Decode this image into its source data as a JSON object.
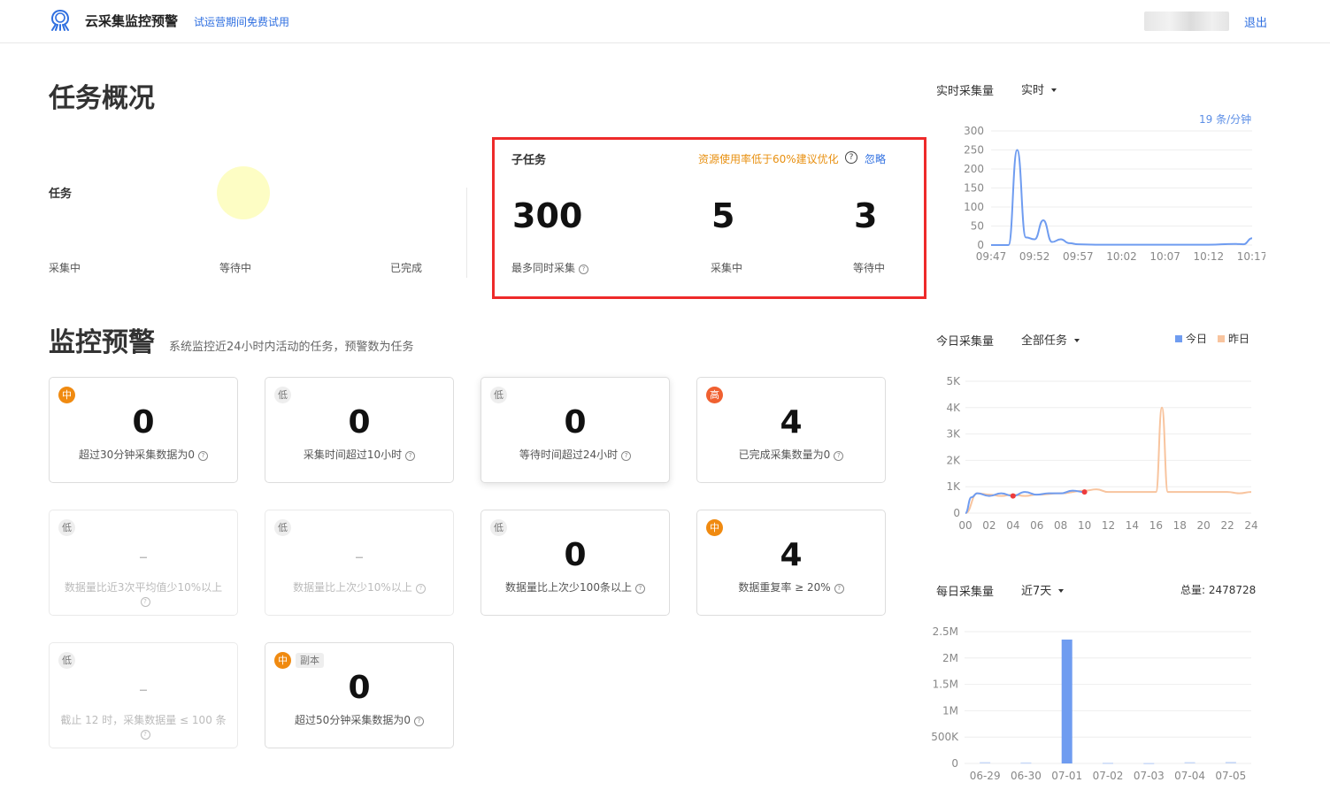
{
  "header": {
    "app_title": "云采集监控预警",
    "trial_text": "试运营期间免费试用",
    "logout": "退出"
  },
  "overview": {
    "title": "任务概况",
    "task_label": "任务",
    "legend": [
      "采集中",
      "等待中",
      "已完成"
    ],
    "subtask": {
      "title": "子任务",
      "warning": "资源使用率低于60%建议优化",
      "ignore": "忽略",
      "stats": [
        {
          "value": "300",
          "label": "最多同时采集"
        },
        {
          "value": "5",
          "label": "采集中"
        },
        {
          "value": "3",
          "label": "等待中"
        }
      ]
    }
  },
  "monitor": {
    "title": "监控预警",
    "subtitle": "系统监控近24小时内活动的任务，预警数为任务",
    "cards": [
      {
        "level": "中",
        "value": "0",
        "desc": "超过30分钟采集数据为0"
      },
      {
        "level": "低",
        "value": "0",
        "desc": "采集时间超过10小时"
      },
      {
        "level": "低",
        "value": "0",
        "desc": "等待时间超过24小时"
      },
      {
        "level": "高",
        "value": "4",
        "desc": "已完成采集数量为0"
      },
      {
        "level": "低",
        "value": "–",
        "desc": "数据量比近3次平均值少10%以上"
      },
      {
        "level": "低",
        "value": "–",
        "desc": "数据量比上次少10%以上"
      },
      {
        "level": "低",
        "value": "0",
        "desc": "数据量比上次少100条以上"
      },
      {
        "level": "中",
        "value": "4",
        "desc": "数据重复率 ≥ 20%"
      },
      {
        "level": "低",
        "value": "–",
        "desc": "截止 12 时，采集数据量 ≤ 100 条"
      },
      {
        "level": "中",
        "tag": "副本",
        "value": "0",
        "desc": "超过50分钟采集数据为0"
      }
    ]
  },
  "realtime": {
    "title": "实时采集量",
    "select": "实时",
    "rate": "19 条/分钟"
  },
  "today": {
    "title": "今日采集量",
    "select": "全部任务",
    "legend_today": "今日",
    "legend_yesterday": "昨日"
  },
  "daily": {
    "title": "每日采集量",
    "select": "近7天",
    "total": "总量: 2478728"
  },
  "colors": {
    "blue": "#6f9cf0",
    "orange": "#f8c49e",
    "accent": "#2f6fe0",
    "alert_red": "#ee2a2a"
  },
  "chart_data": [
    {
      "type": "line",
      "name": "实时采集量",
      "x_ticks": [
        "09:47",
        "09:52",
        "09:57",
        "10:02",
        "10:07",
        "10:12",
        "10:17"
      ],
      "y_ticks": [
        0,
        50,
        100,
        150,
        200,
        250,
        300
      ],
      "ylim": [
        0,
        300
      ],
      "x": [
        "09:47",
        "09:48",
        "09:49",
        "09:50",
        "09:51",
        "09:52",
        "09:53",
        "09:54",
        "09:55",
        "09:56",
        "09:57",
        "09:59",
        "10:02",
        "10:07",
        "10:12",
        "10:15",
        "10:16",
        "10:17"
      ],
      "values": [
        0,
        0,
        0,
        250,
        20,
        15,
        65,
        8,
        15,
        5,
        2,
        1,
        1,
        1,
        1,
        3,
        2,
        18
      ]
    },
    {
      "type": "line",
      "name": "今日采集量",
      "x_ticks": [
        "00",
        "02",
        "04",
        "06",
        "08",
        "10",
        "12",
        "14",
        "16",
        "18",
        "20",
        "22",
        "24"
      ],
      "y_ticks": [
        "0",
        "1K",
        "2K",
        "3K",
        "4K",
        "5K"
      ],
      "ylim": [
        0,
        5000
      ],
      "series": [
        {
          "name": "今日",
          "x": [
            0,
            0.5,
            1,
            2,
            3,
            4,
            5,
            6,
            7,
            8,
            9,
            10
          ],
          "values": [
            0,
            600,
            750,
            650,
            750,
            650,
            800,
            700,
            750,
            750,
            850,
            800
          ]
        },
        {
          "name": "昨日",
          "x": [
            0,
            1,
            2,
            3,
            4,
            5,
            6,
            8,
            10,
            11,
            12,
            14,
            15,
            16,
            16.5,
            17,
            17.5,
            18,
            20,
            22,
            23,
            24
          ],
          "values": [
            0,
            750,
            700,
            650,
            700,
            650,
            700,
            750,
            850,
            900,
            800,
            800,
            800,
            800,
            4000,
            800,
            800,
            800,
            800,
            800,
            750,
            800
          ]
        }
      ]
    },
    {
      "type": "bar",
      "name": "每日采集量",
      "categories": [
        "06-29",
        "06-30",
        "07-01",
        "07-02",
        "07-03",
        "07-04",
        "07-05"
      ],
      "y_ticks": [
        "0",
        "500K",
        "1M",
        "1.5M",
        "2M",
        "2.5M"
      ],
      "ylim": [
        0,
        2500000
      ],
      "values": [
        25000,
        20000,
        2350000,
        15000,
        10000,
        25000,
        30000
      ]
    }
  ]
}
